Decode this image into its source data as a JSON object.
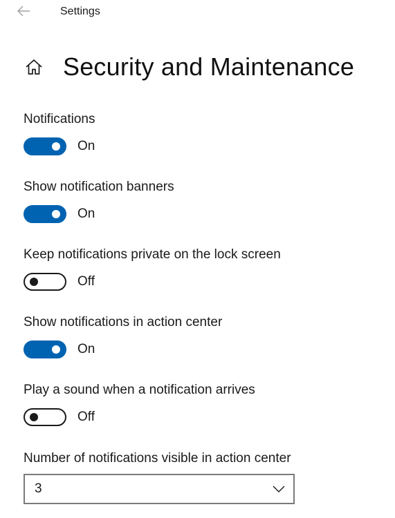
{
  "titlebar": {
    "app_title": "Settings",
    "back_icon": "back-arrow-icon"
  },
  "header": {
    "home_icon": "home-icon",
    "title": "Security and Maintenance"
  },
  "settings": [
    {
      "label": "Notifications",
      "state": "On",
      "enabled": true
    },
    {
      "label": "Show notification banners",
      "state": "On",
      "enabled": true
    },
    {
      "label": "Keep notifications private on the lock screen",
      "state": "Off",
      "enabled": false
    },
    {
      "label": "Show notifications in action center",
      "state": "On",
      "enabled": true
    },
    {
      "label": "Play a sound when a notification arrives",
      "state": "Off",
      "enabled": false
    }
  ],
  "notification_count": {
    "label": "Number of notifications visible in action center",
    "value": "3",
    "icon": "chevron-down-icon"
  },
  "colors": {
    "accent": "#0063b1",
    "text": "#1a1a1a",
    "background": "#ffffff"
  }
}
